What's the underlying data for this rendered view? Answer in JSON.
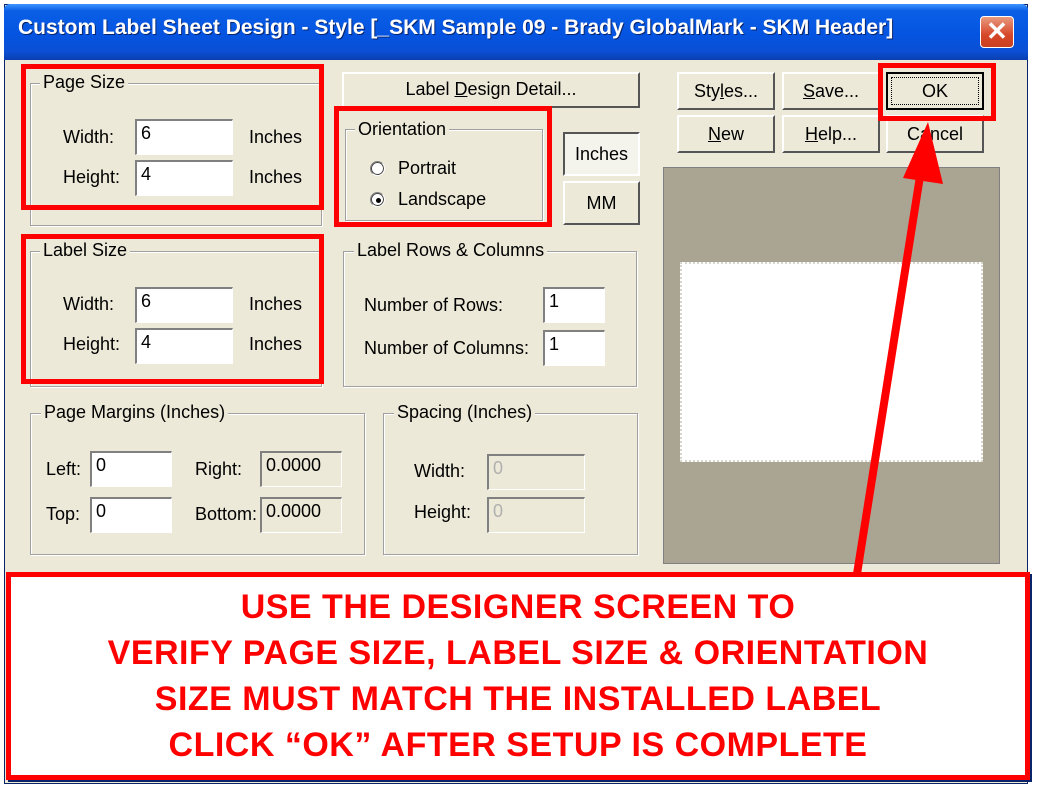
{
  "window": {
    "title": "Custom Label Sheet Design - Style [_SKM Sample 09 - Brady GlobalMark - SKM Header]",
    "close_glyph": "✕"
  },
  "page_size": {
    "legend": "Page Size",
    "width_label": "Width:",
    "width_value": "6",
    "width_unit": "Inches",
    "height_label": "Height:",
    "height_value": "4",
    "height_unit": "Inches"
  },
  "label_size": {
    "legend": "Label Size",
    "width_label": "Width:",
    "width_value": "6",
    "width_unit": "Inches",
    "height_label": "Height:",
    "height_value": "4",
    "height_unit": "Inches"
  },
  "label_design_button": {
    "pre": "Label ",
    "accel": "D",
    "post": "esign Detail..."
  },
  "orientation": {
    "legend": "Orientation",
    "portrait": "Portrait",
    "landscape": "Landscape",
    "selected": "Landscape"
  },
  "units": {
    "inches": "Inches",
    "mm": "MM",
    "selected": "Inches"
  },
  "rows_columns": {
    "legend": "Label Rows & Columns",
    "rows_label": "Number of Rows:",
    "rows_value": "1",
    "columns_label": "Number of Columns:",
    "columns_value": "1"
  },
  "margins": {
    "legend": "Page Margins (Inches)",
    "left_label": "Left:",
    "left_value": "0",
    "right_label": "Right:",
    "right_value": "0.0000",
    "top_label": "Top:",
    "top_value": "0",
    "bottom_label": "Bottom:",
    "bottom_value": "0.0000"
  },
  "spacing": {
    "legend": "Spacing (Inches)",
    "width_label": "Width:",
    "width_value": "0",
    "height_label": "Height:",
    "height_value": "0"
  },
  "buttons": {
    "styles": {
      "pre": "Sty",
      "accel": "l",
      "post": "es..."
    },
    "save": {
      "pre": "",
      "accel": "S",
      "post": "ave..."
    },
    "ok": "OK",
    "new": {
      "pre": "",
      "accel": "N",
      "post": "ew"
    },
    "help": {
      "pre": "",
      "accel": "H",
      "post": "elp..."
    },
    "cancel": "Cancel"
  },
  "annotation": {
    "lines": [
      "USE THE DESIGNER SCREEN TO",
      "VERIFY PAGE SIZE, LABEL SIZE & ORIENTATION",
      "SIZE MUST MATCH THE INSTALLED LABEL",
      "CLICK “OK” AFTER SETUP IS COMPLETE"
    ],
    "color": "#ff0000"
  }
}
